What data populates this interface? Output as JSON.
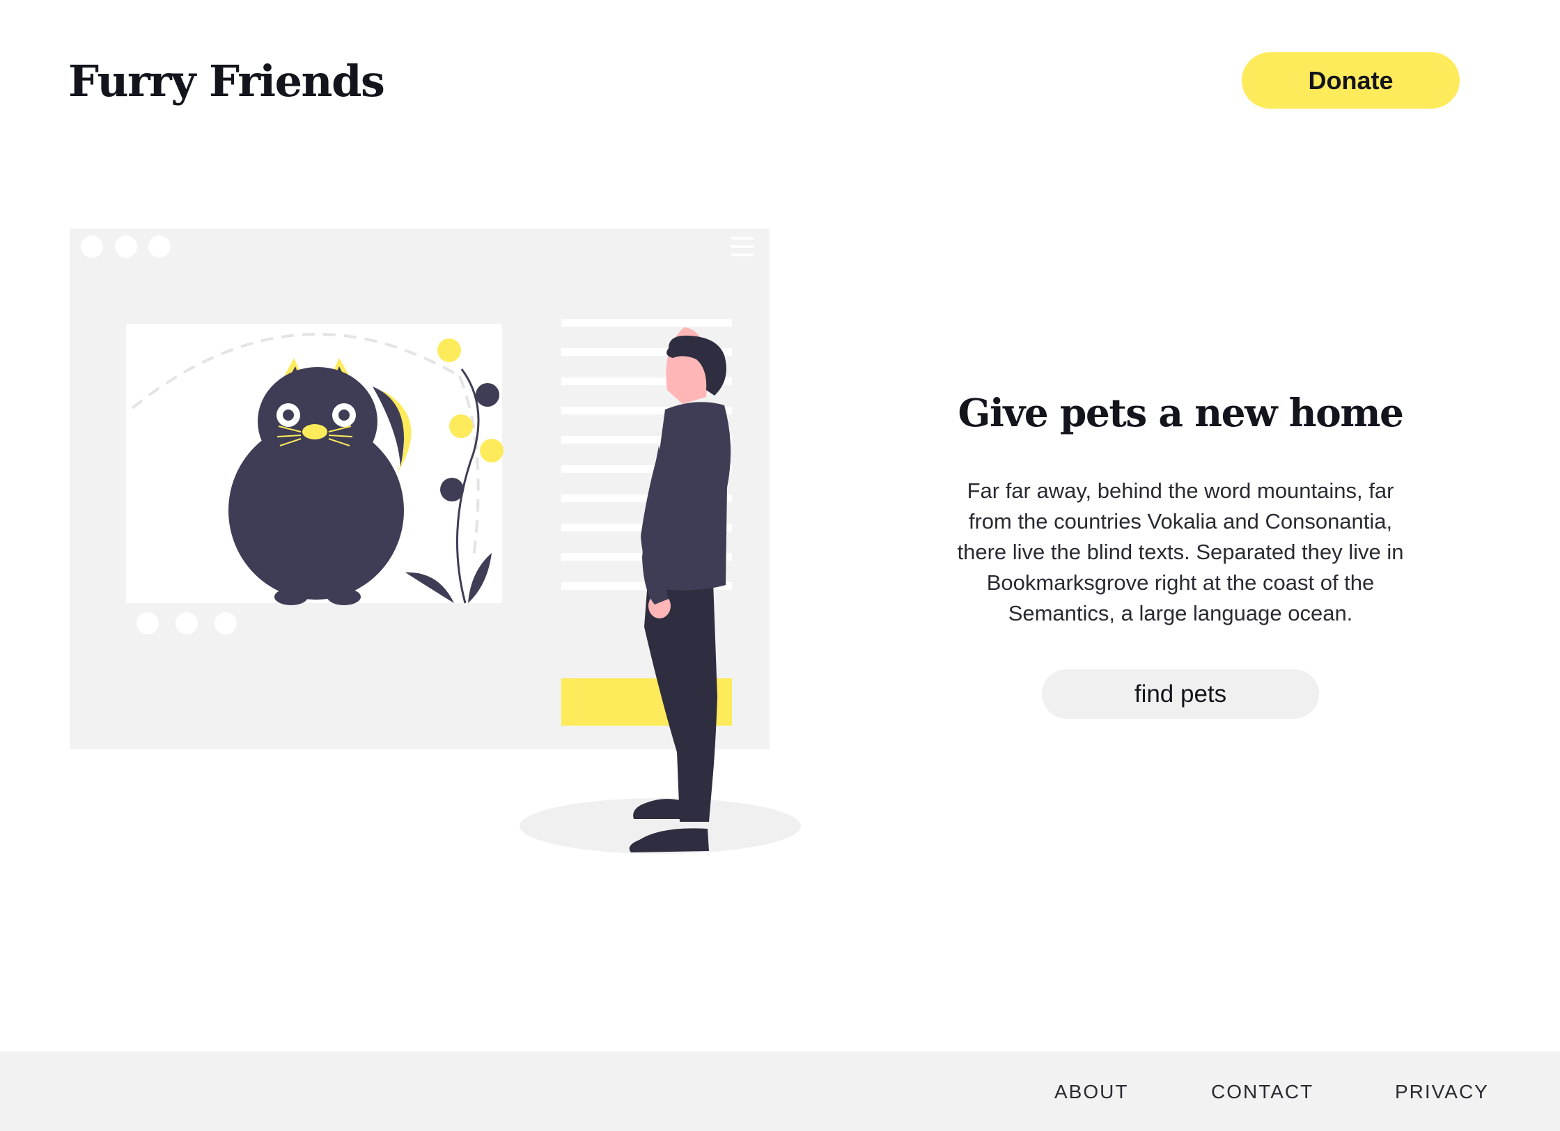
{
  "header": {
    "logo": "Furry Friends",
    "donate_label": "Donate"
  },
  "hero": {
    "title": "Give pets a new home",
    "body": "Far far away, behind the word mountains, far from the countries Vokalia and Consonantia, there live the blind texts. Separated they live in Bookmarksgrove right at the coast of the Semantics, a large language ocean.",
    "cta_label": "find pets"
  },
  "footer": {
    "links": [
      "ABOUT",
      "CONTACT",
      "PRIVACY"
    ]
  },
  "colors": {
    "accent": "#fdeb5c",
    "ink": "#14141c",
    "panel": "#f2f2f2",
    "figure": "#3f3d56"
  },
  "illustration": {
    "icons": [
      "window-dots-icon",
      "hamburger-menu-icon",
      "cat-illustration",
      "person-illustration",
      "plant-illustration"
    ]
  }
}
